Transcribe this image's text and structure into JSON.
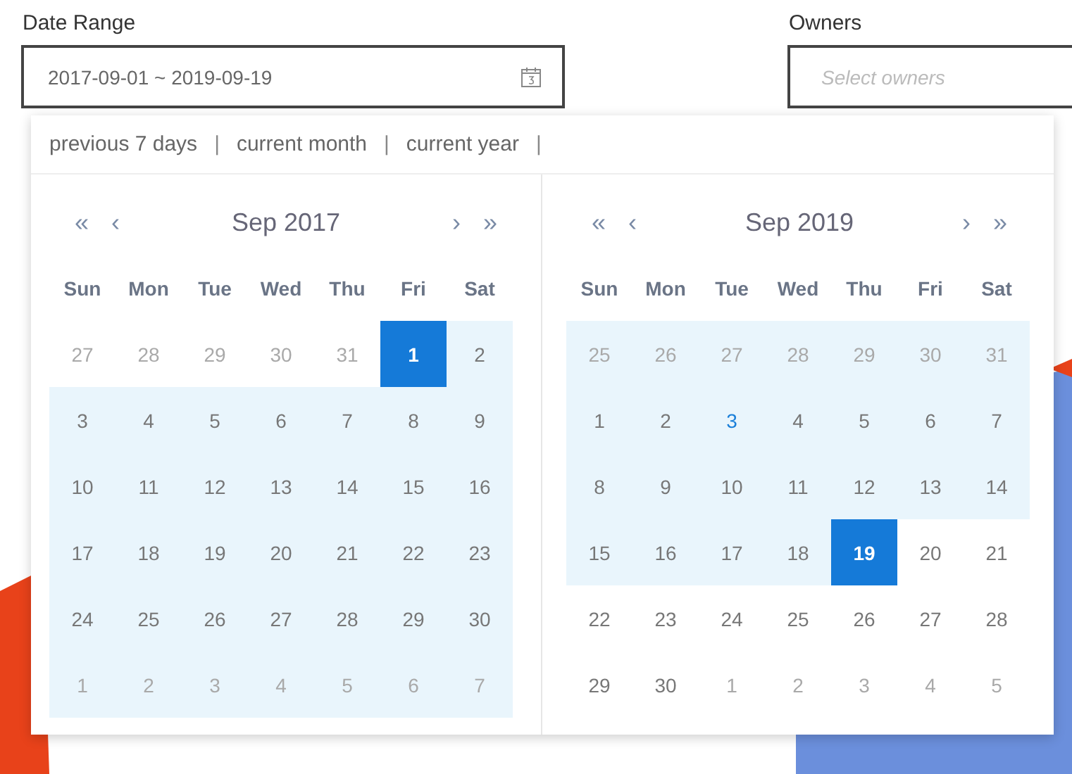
{
  "date_range": {
    "label": "Date Range",
    "value": "2017-09-01 ~ 2019-09-19"
  },
  "owners": {
    "label": "Owners",
    "placeholder": "Select owners"
  },
  "quick_ranges": [
    "previous 7 days",
    "current month",
    "current year"
  ],
  "separator": "|",
  "calendars": [
    {
      "nav_prev_year": "«",
      "nav_prev": "‹",
      "title": "Sep 2017",
      "nav_next": "›",
      "nav_next_year": "»",
      "weekdays": [
        "Sun",
        "Mon",
        "Tue",
        "Wed",
        "Thu",
        "Fri",
        "Sat"
      ],
      "weeks": [
        [
          {
            "d": "27",
            "kind": "muted",
            "in_range": false,
            "selected": false
          },
          {
            "d": "28",
            "kind": "muted",
            "in_range": false,
            "selected": false
          },
          {
            "d": "29",
            "kind": "muted",
            "in_range": false,
            "selected": false
          },
          {
            "d": "30",
            "kind": "muted",
            "in_range": false,
            "selected": false
          },
          {
            "d": "31",
            "kind": "muted",
            "in_range": false,
            "selected": false
          },
          {
            "d": "1",
            "kind": "normal",
            "in_range": true,
            "selected": true
          },
          {
            "d": "2",
            "kind": "normal",
            "in_range": true,
            "selected": false
          }
        ],
        [
          {
            "d": "3",
            "kind": "normal",
            "in_range": true,
            "selected": false
          },
          {
            "d": "4",
            "kind": "normal",
            "in_range": true,
            "selected": false
          },
          {
            "d": "5",
            "kind": "normal",
            "in_range": true,
            "selected": false
          },
          {
            "d": "6",
            "kind": "normal",
            "in_range": true,
            "selected": false
          },
          {
            "d": "7",
            "kind": "normal",
            "in_range": true,
            "selected": false
          },
          {
            "d": "8",
            "kind": "normal",
            "in_range": true,
            "selected": false
          },
          {
            "d": "9",
            "kind": "normal",
            "in_range": true,
            "selected": false
          }
        ],
        [
          {
            "d": "10",
            "kind": "normal",
            "in_range": true,
            "selected": false
          },
          {
            "d": "11",
            "kind": "normal",
            "in_range": true,
            "selected": false
          },
          {
            "d": "12",
            "kind": "normal",
            "in_range": true,
            "selected": false
          },
          {
            "d": "13",
            "kind": "normal",
            "in_range": true,
            "selected": false
          },
          {
            "d": "14",
            "kind": "normal",
            "in_range": true,
            "selected": false
          },
          {
            "d": "15",
            "kind": "normal",
            "in_range": true,
            "selected": false
          },
          {
            "d": "16",
            "kind": "normal",
            "in_range": true,
            "selected": false
          }
        ],
        [
          {
            "d": "17",
            "kind": "normal",
            "in_range": true,
            "selected": false
          },
          {
            "d": "18",
            "kind": "normal",
            "in_range": true,
            "selected": false
          },
          {
            "d": "19",
            "kind": "normal",
            "in_range": true,
            "selected": false
          },
          {
            "d": "20",
            "kind": "normal",
            "in_range": true,
            "selected": false
          },
          {
            "d": "21",
            "kind": "normal",
            "in_range": true,
            "selected": false
          },
          {
            "d": "22",
            "kind": "normal",
            "in_range": true,
            "selected": false
          },
          {
            "d": "23",
            "kind": "normal",
            "in_range": true,
            "selected": false
          }
        ],
        [
          {
            "d": "24",
            "kind": "normal",
            "in_range": true,
            "selected": false
          },
          {
            "d": "25",
            "kind": "normal",
            "in_range": true,
            "selected": false
          },
          {
            "d": "26",
            "kind": "normal",
            "in_range": true,
            "selected": false
          },
          {
            "d": "27",
            "kind": "normal",
            "in_range": true,
            "selected": false
          },
          {
            "d": "28",
            "kind": "normal",
            "in_range": true,
            "selected": false
          },
          {
            "d": "29",
            "kind": "normal",
            "in_range": true,
            "selected": false
          },
          {
            "d": "30",
            "kind": "normal",
            "in_range": true,
            "selected": false
          }
        ],
        [
          {
            "d": "1",
            "kind": "muted",
            "in_range": true,
            "selected": false
          },
          {
            "d": "2",
            "kind": "muted",
            "in_range": true,
            "selected": false
          },
          {
            "d": "3",
            "kind": "muted",
            "in_range": true,
            "selected": false
          },
          {
            "d": "4",
            "kind": "muted",
            "in_range": true,
            "selected": false
          },
          {
            "d": "5",
            "kind": "muted",
            "in_range": true,
            "selected": false
          },
          {
            "d": "6",
            "kind": "muted",
            "in_range": true,
            "selected": false
          },
          {
            "d": "7",
            "kind": "muted",
            "in_range": true,
            "selected": false
          }
        ]
      ]
    },
    {
      "nav_prev_year": "«",
      "nav_prev": "‹",
      "title": "Sep 2019",
      "nav_next": "›",
      "nav_next_year": "»",
      "weekdays": [
        "Sun",
        "Mon",
        "Tue",
        "Wed",
        "Thu",
        "Fri",
        "Sat"
      ],
      "weeks": [
        [
          {
            "d": "25",
            "kind": "muted",
            "in_range": true,
            "selected": false
          },
          {
            "d": "26",
            "kind": "muted",
            "in_range": true,
            "selected": false
          },
          {
            "d": "27",
            "kind": "muted",
            "in_range": true,
            "selected": false
          },
          {
            "d": "28",
            "kind": "muted",
            "in_range": true,
            "selected": false
          },
          {
            "d": "29",
            "kind": "muted",
            "in_range": true,
            "selected": false
          },
          {
            "d": "30",
            "kind": "muted",
            "in_range": true,
            "selected": false
          },
          {
            "d": "31",
            "kind": "muted",
            "in_range": true,
            "selected": false
          }
        ],
        [
          {
            "d": "1",
            "kind": "normal",
            "in_range": true,
            "selected": false
          },
          {
            "d": "2",
            "kind": "normal",
            "in_range": true,
            "selected": false
          },
          {
            "d": "3",
            "kind": "today",
            "in_range": true,
            "selected": false
          },
          {
            "d": "4",
            "kind": "normal",
            "in_range": true,
            "selected": false
          },
          {
            "d": "5",
            "kind": "normal",
            "in_range": true,
            "selected": false
          },
          {
            "d": "6",
            "kind": "normal",
            "in_range": true,
            "selected": false
          },
          {
            "d": "7",
            "kind": "normal",
            "in_range": true,
            "selected": false
          }
        ],
        [
          {
            "d": "8",
            "kind": "normal",
            "in_range": true,
            "selected": false
          },
          {
            "d": "9",
            "kind": "normal",
            "in_range": true,
            "selected": false
          },
          {
            "d": "10",
            "kind": "normal",
            "in_range": true,
            "selected": false
          },
          {
            "d": "11",
            "kind": "normal",
            "in_range": true,
            "selected": false
          },
          {
            "d": "12",
            "kind": "normal",
            "in_range": true,
            "selected": false
          },
          {
            "d": "13",
            "kind": "normal",
            "in_range": true,
            "selected": false
          },
          {
            "d": "14",
            "kind": "normal",
            "in_range": true,
            "selected": false
          }
        ],
        [
          {
            "d": "15",
            "kind": "normal",
            "in_range": true,
            "selected": false
          },
          {
            "d": "16",
            "kind": "normal",
            "in_range": true,
            "selected": false
          },
          {
            "d": "17",
            "kind": "normal",
            "in_range": true,
            "selected": false
          },
          {
            "d": "18",
            "kind": "normal",
            "in_range": true,
            "selected": false
          },
          {
            "d": "19",
            "kind": "normal",
            "in_range": true,
            "selected": true
          },
          {
            "d": "20",
            "kind": "normal",
            "in_range": false,
            "selected": false
          },
          {
            "d": "21",
            "kind": "normal",
            "in_range": false,
            "selected": false
          }
        ],
        [
          {
            "d": "22",
            "kind": "normal",
            "in_range": false,
            "selected": false
          },
          {
            "d": "23",
            "kind": "normal",
            "in_range": false,
            "selected": false
          },
          {
            "d": "24",
            "kind": "normal",
            "in_range": false,
            "selected": false
          },
          {
            "d": "25",
            "kind": "normal",
            "in_range": false,
            "selected": false
          },
          {
            "d": "26",
            "kind": "normal",
            "in_range": false,
            "selected": false
          },
          {
            "d": "27",
            "kind": "normal",
            "in_range": false,
            "selected": false
          },
          {
            "d": "28",
            "kind": "normal",
            "in_range": false,
            "selected": false
          }
        ],
        [
          {
            "d": "29",
            "kind": "normal",
            "in_range": false,
            "selected": false
          },
          {
            "d": "30",
            "kind": "normal",
            "in_range": false,
            "selected": false
          },
          {
            "d": "1",
            "kind": "muted",
            "in_range": false,
            "selected": false
          },
          {
            "d": "2",
            "kind": "muted",
            "in_range": false,
            "selected": false
          },
          {
            "d": "3",
            "kind": "muted",
            "in_range": false,
            "selected": false
          },
          {
            "d": "4",
            "kind": "muted",
            "in_range": false,
            "selected": false
          },
          {
            "d": "5",
            "kind": "muted",
            "in_range": false,
            "selected": false
          }
        ]
      ]
    }
  ]
}
